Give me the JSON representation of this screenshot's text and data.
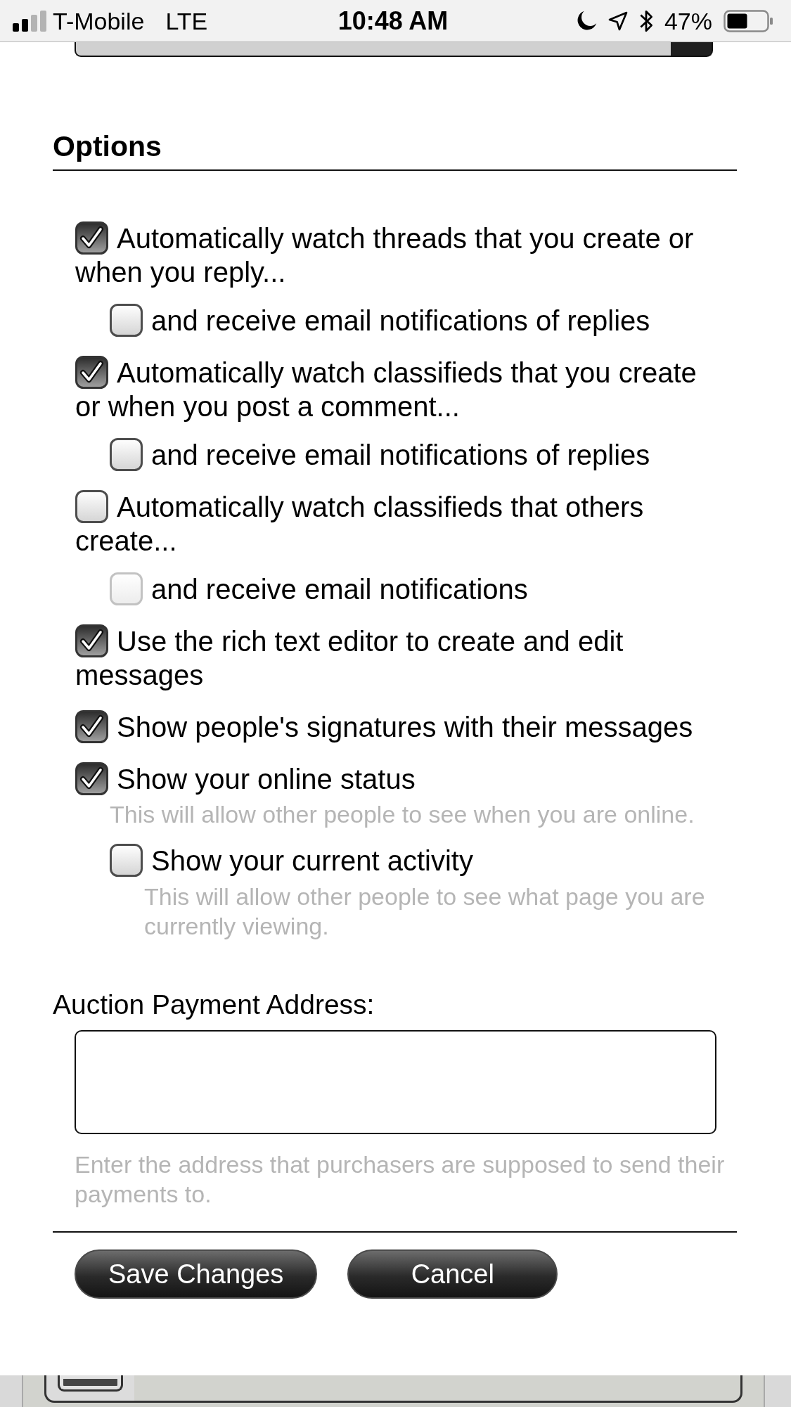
{
  "status_bar": {
    "carrier": "T-Mobile",
    "network": "LTE",
    "time": "10:48 AM",
    "battery": "47%"
  },
  "options": {
    "title": "Options",
    "items": [
      {
        "label": "Automatically watch threads that you create or when you reply...",
        "checked": true,
        "disabled": false,
        "children": [
          {
            "label": "and receive email notifications of replies",
            "checked": false,
            "disabled": false
          }
        ]
      },
      {
        "label": "Automatically watch classifieds that you create or when you post a comment...",
        "checked": true,
        "disabled": false,
        "children": [
          {
            "label": "and receive email notifications of replies",
            "checked": false,
            "disabled": false
          }
        ]
      },
      {
        "label": "Automatically watch classifieds that others create...",
        "checked": false,
        "disabled": false,
        "children": [
          {
            "label": "and receive email notifications",
            "checked": false,
            "disabled": true
          }
        ]
      },
      {
        "label": "Use the rich text editor to create and edit messages",
        "checked": true,
        "disabled": false
      },
      {
        "label": "Show people's signatures with their messages",
        "checked": true,
        "disabled": false
      },
      {
        "label": "Show your online status",
        "checked": true,
        "disabled": false,
        "hint": "This will allow other people to see when you are online.",
        "children": [
          {
            "label": "Show your current activity",
            "checked": false,
            "disabled": false,
            "hint": "This will allow other people to see what page you are currently viewing."
          }
        ]
      }
    ]
  },
  "auction_payment_address": {
    "label": "Auction Payment Address:",
    "hint": "Enter the address that purchasers are supposed to send their payments to."
  },
  "buttons": [
    {
      "label": "Save Changes"
    },
    {
      "label": "Cancel"
    }
  ]
}
